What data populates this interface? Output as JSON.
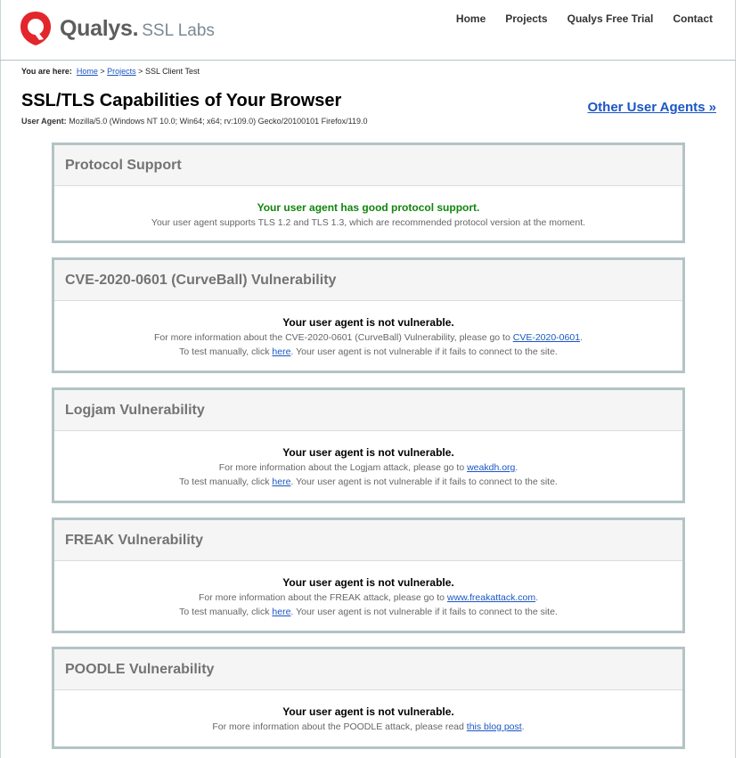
{
  "header": {
    "brand": "Qualys.",
    "product": "SSL Labs",
    "brand_color": "#e2262c",
    "nav": [
      "Home",
      "Projects",
      "Qualys Free Trial",
      "Contact"
    ]
  },
  "breadcrumb": {
    "prefix": "You are here:",
    "home": "Home",
    "sep1": " > ",
    "projects": "Projects",
    "sep2": " > ",
    "current": "SSL Client Test"
  },
  "title": "SSL/TLS Capabilities of Your Browser",
  "user_agent": {
    "label": "User Agent:",
    "value": "Mozilla/5.0 (Windows NT 10.0; Win64; x64; rv:109.0) Gecko/20100101 Firefox/119.0"
  },
  "other_agents": "Other User Agents »",
  "panels": {
    "protocol": {
      "title": "Protocol Support",
      "status": "Your user agent has good protocol support.",
      "detail": "Your user agent supports TLS 1.2 and TLS 1.3, which are recommended protocol version at the moment."
    },
    "curveball": {
      "title": "CVE-2020-0601 (CurveBall) Vulnerability",
      "status": "Your user agent is not vulnerable.",
      "info_pre": "For more information about the CVE-2020-0601 (CurveBall) Vulnerability, please go to ",
      "info_link": "CVE-2020-0601",
      "info_post": ".",
      "test_pre": "To test manually, click ",
      "test_link": "here",
      "test_post": ". Your user agent is not vulnerable if it fails to connect to the site."
    },
    "logjam": {
      "title": "Logjam Vulnerability",
      "status": "Your user agent is not vulnerable.",
      "info_pre": "For more information about the Logjam attack, please go to ",
      "info_link": "weakdh.org",
      "info_post": ".",
      "test_pre": "To test manually, click ",
      "test_link": "here",
      "test_post": ". Your user agent is not vulnerable if it fails to connect to the site."
    },
    "freak": {
      "title": "FREAK Vulnerability",
      "status": "Your user agent is not vulnerable.",
      "info_pre": "For more information about the FREAK attack, please go to ",
      "info_link": "www.freakattack.com",
      "info_post": ".",
      "test_pre": "To test manually, click ",
      "test_link": "here",
      "test_post": ". Your user agent is not vulnerable if it fails to connect to the site."
    },
    "poodle": {
      "title": "POODLE Vulnerability",
      "status": "Your user agent is not vulnerable.",
      "info_pre": "For more information about the POODLE attack, please read ",
      "info_link": "this blog post",
      "info_post": "."
    }
  }
}
